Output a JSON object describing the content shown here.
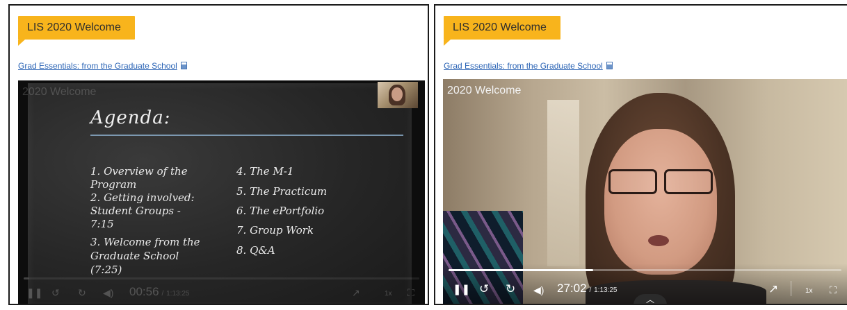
{
  "panels": [
    {
      "banner_title": "LIS 2020 Welcome",
      "link_text": "Grad Essentials: from the Graduate School",
      "video": {
        "title": "2020 Welcome",
        "slide": {
          "heading": "Agenda:",
          "left_items": [
            "1.  Overview of the",
            "     Program",
            "2.  Getting involved:",
            "     Student Groups -",
            "     7:15",
            "3.  Welcome from the",
            "     Graduate School",
            "     (7:25)"
          ],
          "right_items": [
            "4. The M-1",
            "5. The Practicum",
            "6. The ePortfolio",
            "7. Group Work",
            "8. Q&A"
          ]
        },
        "player": {
          "current_time": "00:56",
          "separator": "/",
          "total_time": "1:13:25",
          "speed": "1x",
          "progress": 0.013
        }
      }
    },
    {
      "banner_title": "LIS 2020 Welcome",
      "link_text": "Grad Essentials: from the Graduate School",
      "video": {
        "title": "2020 Welcome",
        "player": {
          "current_time": "27:02",
          "separator": "/",
          "total_time": "1:13:25",
          "speed": "1x",
          "progress": 0.368
        }
      }
    }
  ],
  "icons": {
    "pause": "pause-icon",
    "rewind": "rewind-15-icon",
    "forward": "forward-15-icon",
    "volume": "volume-icon",
    "popout": "popout-arrow-icon",
    "fullscreen": "fullscreen-icon",
    "expand": "chevron-up-icon",
    "link_doc": "document-link-icon"
  },
  "colors": {
    "banner": "#f8b41c",
    "link": "#2b64b5",
    "panel_border": "#1a1a1a"
  }
}
